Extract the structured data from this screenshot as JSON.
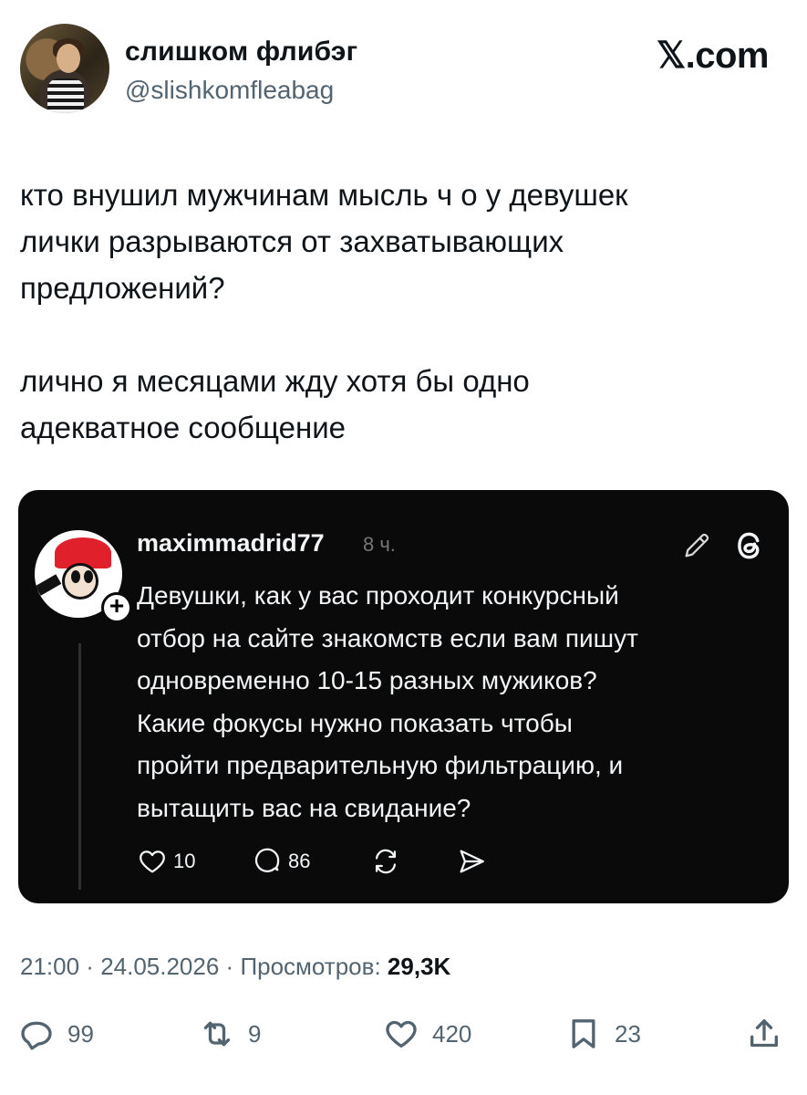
{
  "author": {
    "display_name": "слишком флибэг",
    "handle": "@slishkomfleabag",
    "avatar_icon": "profile-photo"
  },
  "brand": {
    "label": "𝕏.com"
  },
  "tweet": {
    "text": "кто внушил мужчинам мысль ч о у девушек\nлички разрываются от захватывающих\nпредложений?\n\nлично я месяцами жду хотя бы одно\nадекватное сообщение"
  },
  "quoted_post": {
    "username": "maximmadrid77",
    "time": "8 ч.",
    "plus_badge": "+",
    "text": "Девушки, как у вас проходит конкурсный\nотбор на сайте знакомств если вам пишут\nодновременно 10-15 разных мужиков?\nКакие фокусы  нужно показать чтобы\nпройти предварительную фильтрацию, и\nвытащить вас на свидание?",
    "likes": "10",
    "replies": "86",
    "icons": [
      "heart-icon",
      "comment-icon",
      "repost-icon",
      "send-icon",
      "edit-icon",
      "threads-logo-icon"
    ]
  },
  "meta": {
    "time": "21:00",
    "separator": " · ",
    "date": "24.05.2026",
    "views_label": "Просмотров:",
    "views_count": "29,3K"
  },
  "actions": {
    "replies": "99",
    "reposts": "9",
    "likes": "420",
    "bookmarks": "23",
    "icons": [
      "reply-icon",
      "repost-icon",
      "like-icon",
      "bookmark-icon",
      "share-icon"
    ]
  },
  "colors": {
    "text": "#0f1419",
    "secondary": "#536471",
    "card_bg": "#0a0a0a",
    "card_text": "#f3f5f7"
  }
}
